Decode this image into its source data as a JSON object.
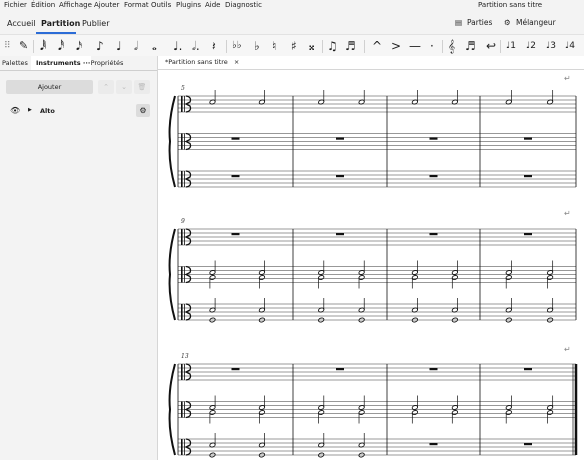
{
  "window_title": "Partition sans titre",
  "menu": [
    "Fichier",
    "Édition",
    "Affichage",
    "Ajouter",
    "Format",
    "Outils",
    "Plugins",
    "Aide",
    "Diagnostic"
  ],
  "nav_tabs": [
    "Accueil",
    "Partition",
    "Publier"
  ],
  "header_right": {
    "parts": "Parties",
    "mixer": "Mélangeur"
  },
  "toolbar_glyphs": [
    "✎",
    "𝅘𝅥𝅱",
    "𝅘𝅥𝅰",
    "𝅘𝅥𝅯",
    "♪",
    "♩",
    "𝅗𝅥",
    "𝅝",
    "♩.",
    "𝅗𝅥.",
    "𝄽",
    "♭♭",
    "♭",
    "♮",
    "♯",
    "𝄪",
    "♫",
    "♬",
    "^",
    ">",
    "—",
    "·",
    "𝄞",
    "♬",
    "↩",
    "1",
    "2",
    "3",
    "4"
  ],
  "panel_tabs": [
    "Palettes",
    "Instruments",
    "Propriétés"
  ],
  "panel_tab_more": "···",
  "add_label": "Ajouter",
  "instrument": "Alto",
  "score_tab": "*Partition sans titre",
  "score_tab_close": "×",
  "systems": [
    {
      "measure_number": "5"
    },
    {
      "measure_number": "9"
    },
    {
      "measure_number": "13"
    }
  ]
}
